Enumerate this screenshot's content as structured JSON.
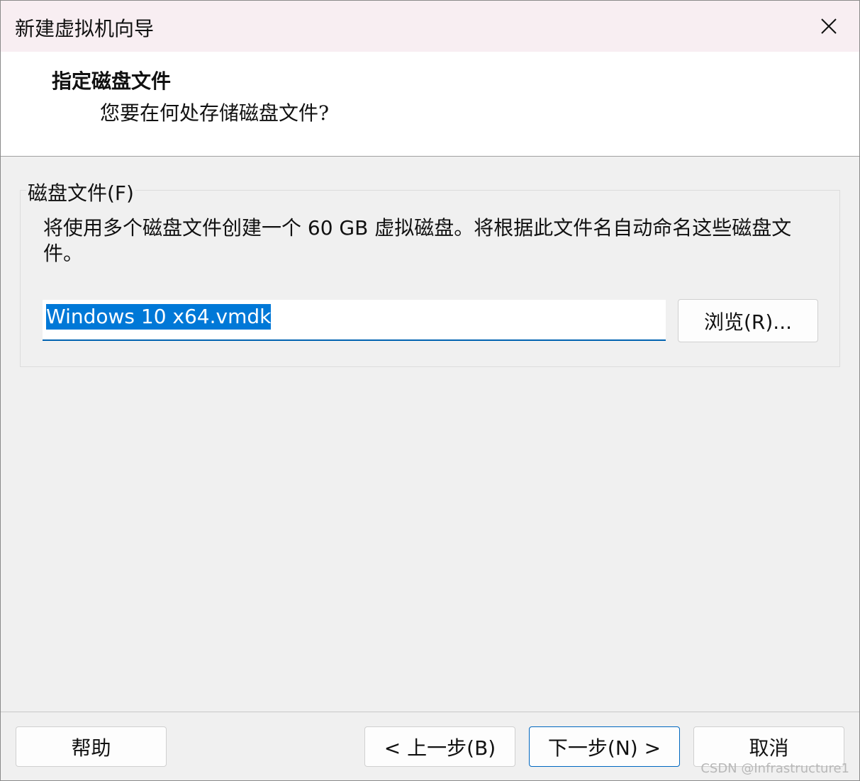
{
  "window": {
    "title": "新建虚拟机向导",
    "close_icon": "close-icon"
  },
  "header": {
    "title": "指定磁盘文件",
    "subtitle": "您要在何处存储磁盘文件?"
  },
  "disk_group": {
    "legend": "磁盘文件(F)",
    "description": "将使用多个磁盘文件创建一个 60 GB 虚拟磁盘。将根据此文件名自动命名这些磁盘文件。",
    "filename_value": "Windows 10 x64.vmdk",
    "browse_label": "浏览(R)..."
  },
  "footer": {
    "help_label": "帮助",
    "back_label": "< 上一步(B)",
    "next_label": "下一步(N) >",
    "cancel_label": "取消"
  },
  "watermark": "CSDN @Infrastructure1",
  "colors": {
    "accent": "#0078d7",
    "titlebar": "#f8eef2",
    "dialog_bg": "#f0f0f0"
  }
}
